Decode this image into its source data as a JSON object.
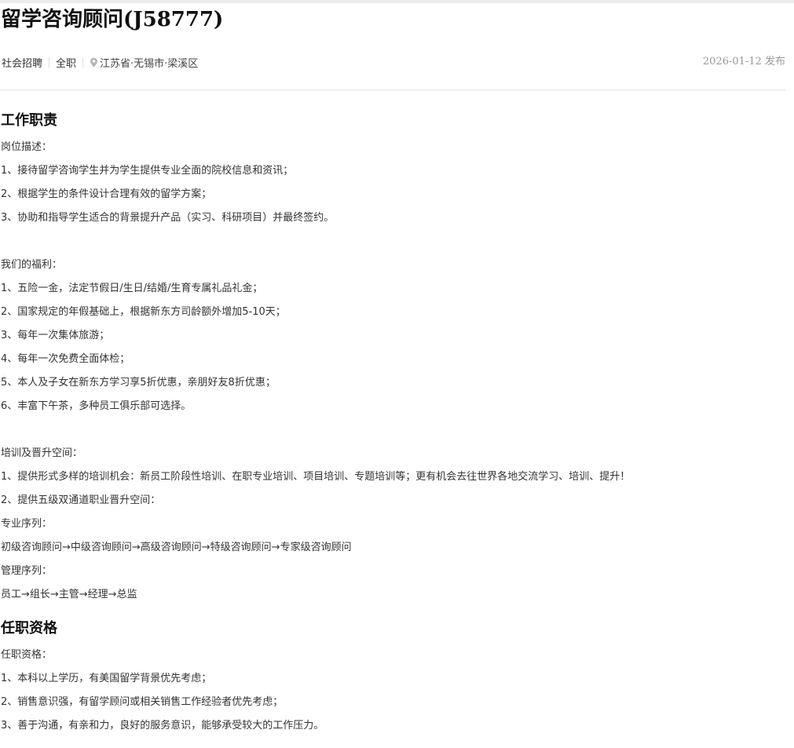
{
  "job": {
    "title": "留学咨询顾问(J58777)",
    "recruit_type": "社会招聘",
    "employment_type": "全职",
    "location": "江苏省·无锡市·梁溪区",
    "publish_date": "2026-01-12 发布"
  },
  "duties": {
    "heading": "工作职责",
    "lines": [
      "岗位描述：",
      "1、接待留学咨询学生并为学生提供专业全面的院校信息和资讯；",
      "2、根据学生的条件设计合理有效的留学方案；",
      "3、协助和指导学生适合的背景提升产品（实习、科研项目）并最终签约。",
      "",
      "我们的福利：",
      "1、五险一金，法定节假日/生日/结婚/生育专属礼品礼金；",
      "2、国家规定的年假基础上，根据新东方司龄额外增加5-10天；",
      "3、每年一次集体旅游；",
      "4、每年一次免费全面体检；",
      "5、本人及子女在新东方学习享5折优惠，亲朋好友8折优惠；",
      "6、丰富下午茶，多种员工俱乐部可选择。",
      "",
      "培训及晋升空间：",
      "1、提供形式多样的培训机会：新员工阶段性培训、在职专业培训、项目培训、专题培训等；更有机会去往世界各地交流学习、培训、提升！",
      "2、提供五级双通道职业晋升空间：",
      "专业序列：",
      "初级咨询顾问→中级咨询顾问→高级咨询顾问→特级咨询顾问→专家级咨询顾问",
      "管理序列：",
      "员工→组长→主管→经理→总监"
    ]
  },
  "requirements": {
    "heading": "任职资格",
    "lines": [
      "任职资格：",
      "1、本科以上学历，有美国留学背景优先考虑；",
      "2、销售意识强，有留学顾问或相关销售工作经验者优先考虑；",
      "3、善于沟通，有亲和力，良好的服务意识，能够承受较大的工作压力。"
    ]
  },
  "icons": {
    "location": "map-pin-icon"
  },
  "colors": {
    "text": "#333333",
    "muted": "#999999",
    "divider": "#e5e5e5",
    "pin": "#b5b5b5"
  }
}
